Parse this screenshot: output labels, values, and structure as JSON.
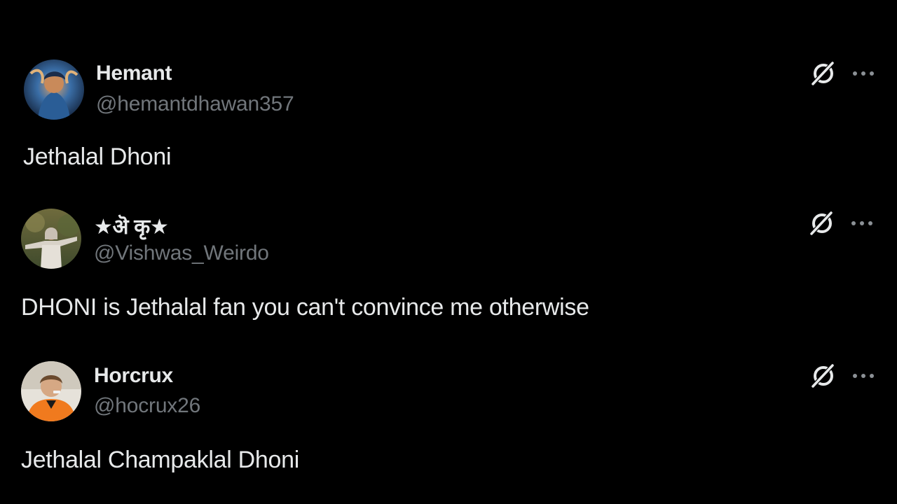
{
  "posts": [
    {
      "display_name": "Hemant",
      "handle": "@hemantdhawan357",
      "text": "Jethalal Dhoni",
      "avatar": "avatar-illustration-blue-orange",
      "actions": {
        "grok_icon": "grok-icon",
        "more_icon": "more-icon"
      }
    },
    {
      "display_name": "★ऄ कृ★",
      "handle": "@Vishwas_Weirdo",
      "text": "DHONI is Jethalal fan you can't convince me otherwise",
      "avatar": "avatar-person-photo",
      "actions": {
        "grok_icon": "grok-icon",
        "more_icon": "more-icon"
      }
    },
    {
      "display_name": "Horcrux",
      "handle": "@hocrux26",
      "text": "Jethalal Champaklal Dhoni",
      "avatar": "avatar-person-orange-jersey",
      "actions": {
        "grok_icon": "grok-icon",
        "more_icon": "more-icon"
      }
    }
  ],
  "colors": {
    "background": "#000000",
    "primary_text": "#e7e9ea",
    "secondary_text": "#71767b"
  }
}
